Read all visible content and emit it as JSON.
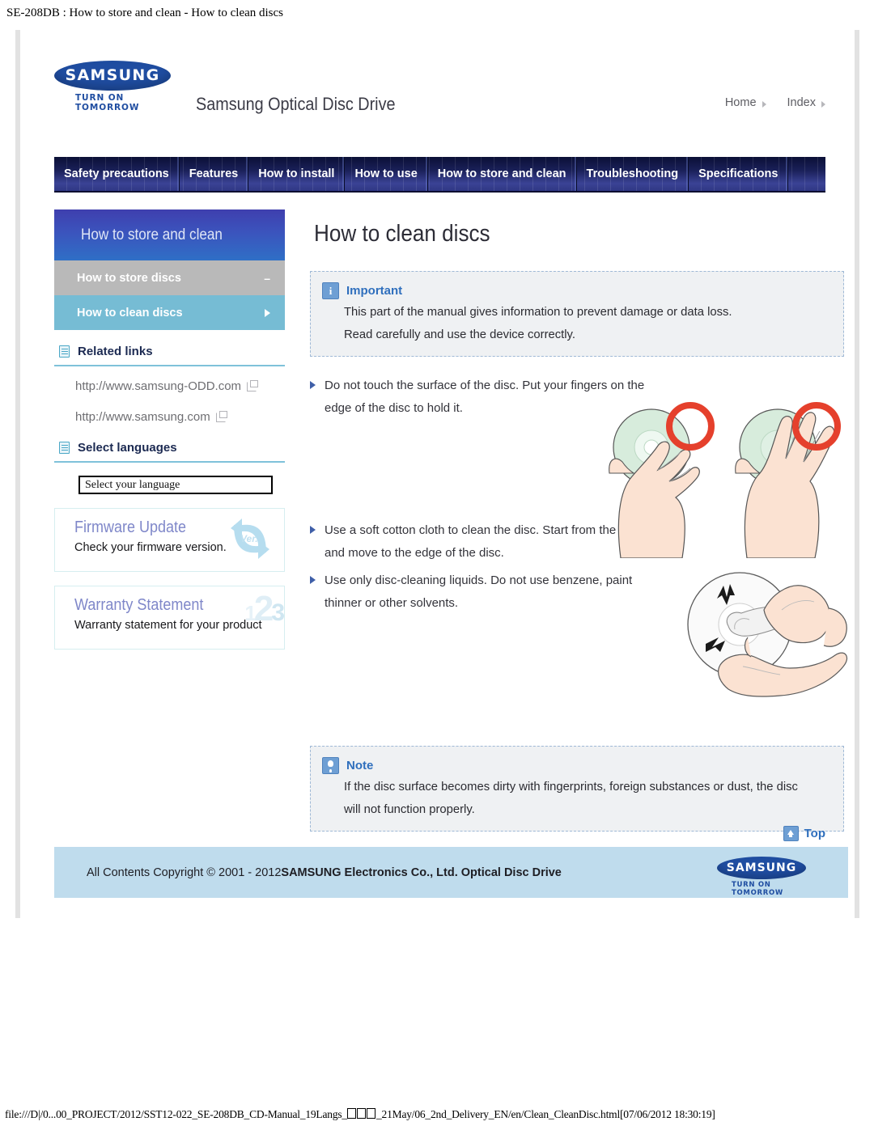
{
  "print_header": "SE-208DB : How to store and clean - How to clean discs",
  "print_footer": {
    "prefix": "file:///D|/0...00_PROJECT/2012/SST12-022_SE-208DB_CD-Manual_19Langs_",
    "suffix": "_21May/06_2nd_Delivery_EN/en/Clean_CleanDisc.html[07/06/2012 18:30:19]"
  },
  "brand": {
    "logo_word": "SAMSUNG",
    "logo_tagline": "TURN ON TOMORROW",
    "site_title": "Samsung Optical Disc Drive"
  },
  "toplinks": [
    {
      "label": "Home"
    },
    {
      "label": "Index"
    }
  ],
  "tabs": [
    {
      "label": "Safety precautions"
    },
    {
      "label": "Features"
    },
    {
      "label": "How to install"
    },
    {
      "label": "How to use"
    },
    {
      "label": "How to store and clean"
    },
    {
      "label": "Troubleshooting"
    },
    {
      "label": "Specifications"
    }
  ],
  "sidebar": {
    "header": "How to store and clean",
    "items": [
      {
        "label": "How to store discs",
        "marker": "dash"
      },
      {
        "label": "How to clean discs",
        "marker": "caret"
      }
    ],
    "related_links": {
      "title": "Related links",
      "links": [
        {
          "label": "http://www.samsung-ODD.com"
        },
        {
          "label": "http://www.samsung.com"
        }
      ]
    },
    "select_languages": {
      "title": "Select languages",
      "select_value": "Select your language"
    },
    "promos": [
      {
        "title": "Firmware Update",
        "subtitle": "Check your firmware version.",
        "art_label": "Ver."
      },
      {
        "title": "Warranty Statement",
        "subtitle": "Warranty statement for your product",
        "art_label": "123"
      }
    ]
  },
  "main": {
    "title": "How to clean discs",
    "important": {
      "heading": "Important",
      "lines": [
        "This part of the manual gives information to prevent damage or data loss.",
        "Read carefully and use the device correctly."
      ]
    },
    "bullets": [
      {
        "text": "Do not touch the surface of the disc. Put your fingers on the edge of the disc to hold it."
      },
      {
        "text": "Use a soft cotton cloth to clean the disc. Start from the center and move to the edge of the disc."
      },
      {
        "text": "Use only disc-cleaning liquids. Do not use benzene, paint thinner or other solvents."
      }
    ],
    "note": {
      "heading": "Note",
      "lines": [
        "If the disc surface becomes dirty with fingerprints, foreign substances or dust, the disc",
        "will not function properly."
      ]
    },
    "top_link": "Top"
  },
  "footer": {
    "copyright_plain": "All Contents Copyright © 2001 - 2012",
    "copyright_bold": "SAMSUNG Electronics Co., Ltd. Optical Disc Drive",
    "logo_word": "SAMSUNG",
    "logo_tagline": "TURN ON TOMORROW"
  },
  "colors": {
    "brand_blue": "#1f4da1",
    "tab_navy": "#1a2059",
    "sidebar_active": "#76bcd4",
    "sidebar_grey": "#b9b9b9",
    "accent_link": "#2f6fbd",
    "footer_bg": "#bfdced",
    "rule_cyan": "#7fc2da"
  }
}
